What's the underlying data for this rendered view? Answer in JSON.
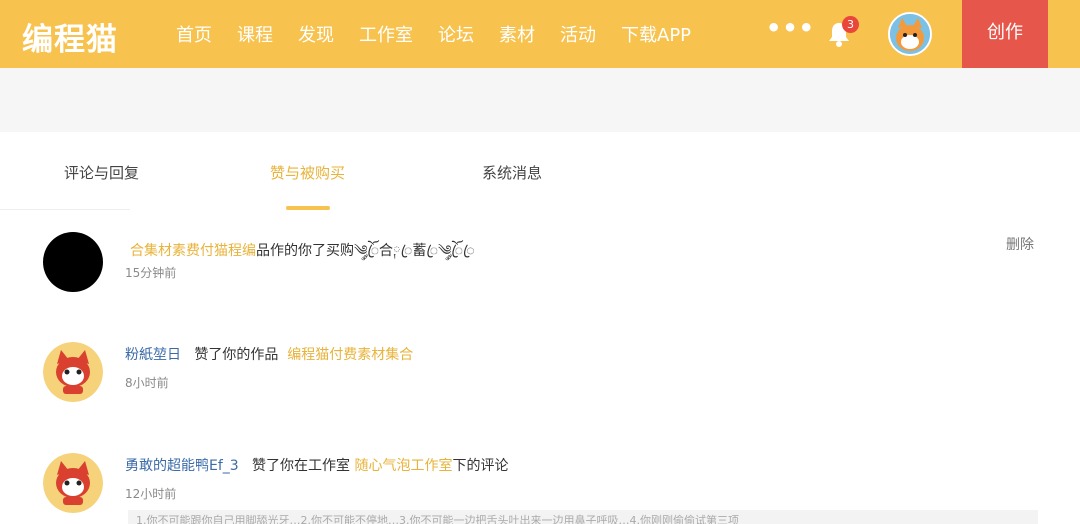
{
  "header": {
    "logo": "编程猫",
    "nav": [
      "首页",
      "课程",
      "发现",
      "工作室",
      "论坛",
      "素材",
      "活动",
      "下载APP"
    ],
    "more": "•••",
    "notification_count": "3",
    "create_label": "创作",
    "brand_color": "#f7c24e",
    "create_color": "#e6564a"
  },
  "tabs": [
    {
      "label": "评论与回复"
    },
    {
      "label": "赞与被购买"
    },
    {
      "label": "系统消息"
    }
  ],
  "messages": [
    {
      "link": "合集材素费付猫程编",
      "text": "品作的你了买购༄ོ༘ꦿ合༙ꦿ蓄ꦿ༄ོ༘ꦿꦿ",
      "time": "15分钟前",
      "delete": "删除"
    },
    {
      "user": "粉紙堃日",
      "action": "赞了你的作品",
      "target": "编程猫付费素材集合",
      "time": "8小时前"
    },
    {
      "user": "勇敢的超能鸭Ef_3",
      "action": "赞了你在工作室",
      "target": "随心气泡工作室",
      "suffix": "下的评论",
      "time": "12小时前"
    }
  ],
  "bottom_snippet": "1.你不可能跟你自己用脚舔光牙…2.你不可能不停地…3.你不可能一边把舌头吐出来一边用鼻子呼吸…4.你刚刚偷偷试第三项"
}
